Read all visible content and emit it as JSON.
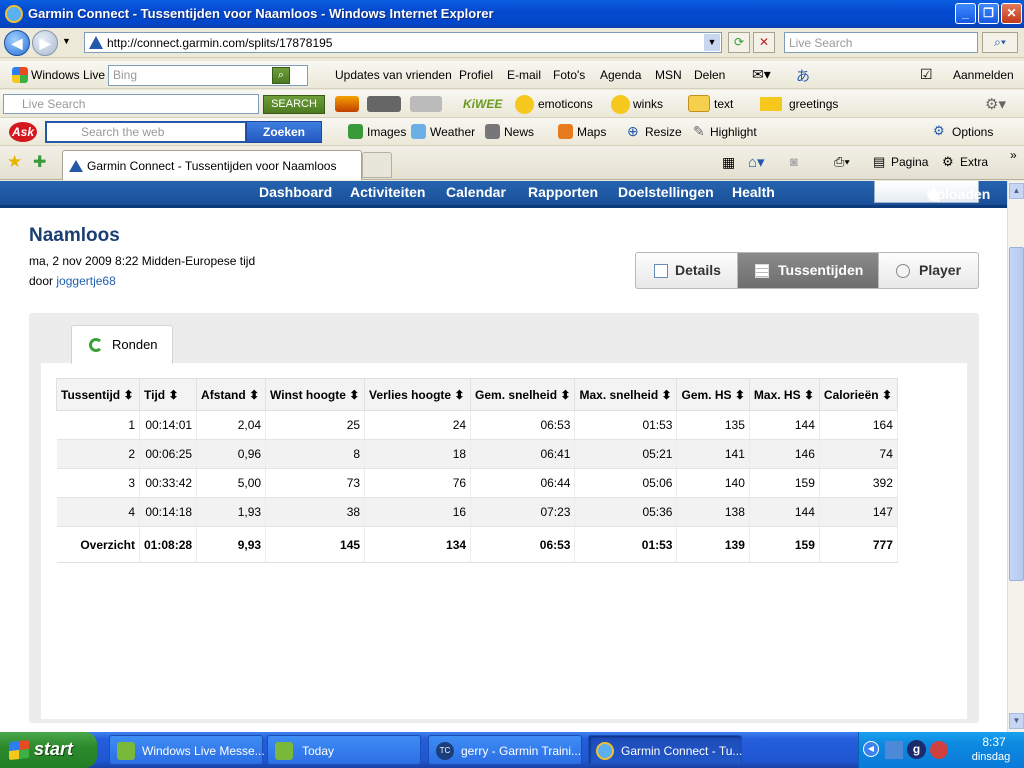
{
  "window": {
    "title": "Garmin Connect - Tussentijden voor Naamloos - Windows Internet Explorer"
  },
  "address": {
    "url": "http://connect.garmin.com/splits/17878195",
    "live_search_placeholder": "Live Search"
  },
  "msn_toolbar": {
    "brand": "Windows Live",
    "search_placeholder": "Bing",
    "links": [
      "Updates van vrienden",
      "Profiel",
      "E-mail",
      "Foto's",
      "Agenda",
      "MSN",
      "Delen"
    ],
    "signin": "Aanmelden"
  },
  "live_toolbar": {
    "search_placeholder": "Live Search",
    "search_button": "SEARCH",
    "brand": "KiWEE",
    "items": [
      "emoticons",
      "winks",
      "text",
      "greetings"
    ]
  },
  "ask_toolbar": {
    "logo": "Ask",
    "search_placeholder": "Search the web",
    "search_button": "Zoeken",
    "items": [
      "Images",
      "Weather",
      "News",
      "Maps",
      "Resize",
      "Highlight"
    ],
    "options": "Options"
  },
  "tabs": {
    "active": "Garmin Connect - Tussentijden voor Naamloos",
    "page_menu": "Pagina",
    "extra_menu": "Extra"
  },
  "garmin_nav": {
    "items": [
      "Dashboard",
      "Activiteiten",
      "Calendar",
      "Rapporten",
      "Doelstellingen",
      "Health"
    ],
    "upload": "Uploaden"
  },
  "activity": {
    "name": "Naamloos",
    "datetime": "ma, 2 nov 2009 8:22 Midden-Europese tijd",
    "by_label": "door",
    "user": "joggertje68"
  },
  "views": {
    "details": "Details",
    "splits": "Tussentijden",
    "player": "Player"
  },
  "splits": {
    "tab": "Ronden",
    "columns": [
      "Tussentijd",
      "Tijd",
      "Afstand",
      "Winst hoogte",
      "Verlies hoogte",
      "Gem. snelheid",
      "Max. snelheid",
      "Gem. HS",
      "Max. HS",
      "Calorieën"
    ],
    "sort_glyph": "⬍",
    "rows": [
      [
        "1",
        "00:14:01",
        "2,04",
        "25",
        "24",
        "06:53",
        "01:53",
        "135",
        "144",
        "164"
      ],
      [
        "2",
        "00:06:25",
        "0,96",
        "8",
        "18",
        "06:41",
        "05:21",
        "141",
        "146",
        "74"
      ],
      [
        "3",
        "00:33:42",
        "5,00",
        "73",
        "76",
        "06:44",
        "05:06",
        "140",
        "159",
        "392"
      ],
      [
        "4",
        "00:14:18",
        "1,93",
        "38",
        "16",
        "07:23",
        "05:36",
        "138",
        "144",
        "147"
      ]
    ],
    "total": [
      "Overzicht",
      "01:08:28",
      "9,93",
      "145",
      "134",
      "06:53",
      "01:53",
      "139",
      "159",
      "777"
    ]
  },
  "taskbar": {
    "start": "start",
    "tasks": [
      "Windows Live Messe...",
      "Today",
      "gerry - Garmin Traini...",
      "Garmin Connect - Tu..."
    ],
    "time": "8:37",
    "day": "dinsdag"
  }
}
